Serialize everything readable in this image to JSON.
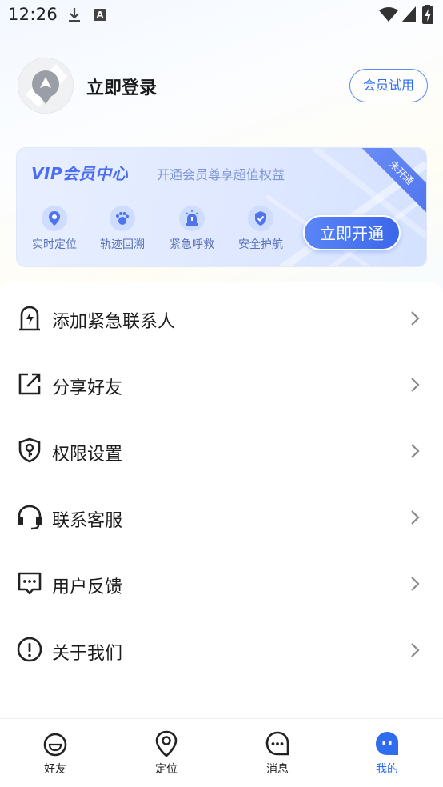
{
  "status_bar": {
    "time": "12:26",
    "a_badge": "A"
  },
  "profile": {
    "login_text": "立即登录",
    "trial_button": "会员试用"
  },
  "vip": {
    "title": "VIP会员中心",
    "subtitle": "开通会员尊享超值权益",
    "ribbon": "未开通",
    "benefits": [
      {
        "label": "实时定位",
        "icon": "location-pin-icon"
      },
      {
        "label": "轨迹回溯",
        "icon": "footprint-icon"
      },
      {
        "label": "紧急呼救",
        "icon": "alarm-icon"
      },
      {
        "label": "安全护航",
        "icon": "shield-check-icon"
      }
    ],
    "open_button": "立即开通",
    "accent": "#3b67ea"
  },
  "menu": [
    {
      "label": "添加紧急联系人",
      "icon": "emergency-contact-icon"
    },
    {
      "label": "分享好友",
      "icon": "share-icon"
    },
    {
      "label": "权限设置",
      "icon": "permission-shield-icon"
    },
    {
      "label": "联系客服",
      "icon": "headset-icon"
    },
    {
      "label": "用户反馈",
      "icon": "feedback-icon"
    },
    {
      "label": "关于我们",
      "icon": "info-icon"
    }
  ],
  "tabs": [
    {
      "label": "好友",
      "icon": "friends-icon",
      "active": false
    },
    {
      "label": "定位",
      "icon": "location-icon",
      "active": false
    },
    {
      "label": "消息",
      "icon": "message-icon",
      "active": false
    },
    {
      "label": "我的",
      "icon": "profile-icon",
      "active": true
    }
  ]
}
